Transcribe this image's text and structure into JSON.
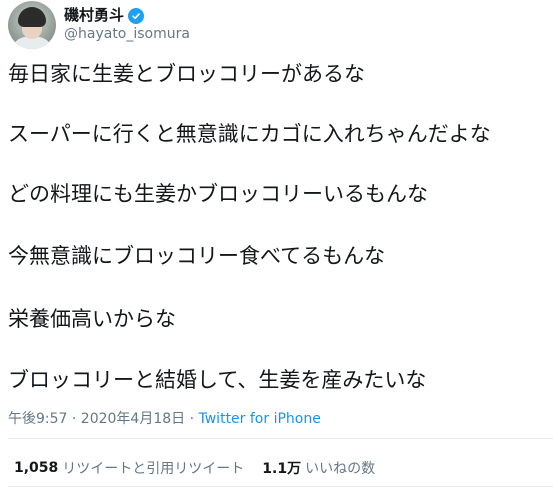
{
  "author": {
    "display_name": "磯村勇斗",
    "handle": "@hayato_isomura",
    "verified": true
  },
  "tweet": {
    "lines": [
      "毎日家に生姜とブロッコリーがあるな",
      "スーパーに行くと無意識にカゴに入れちゃんだよな",
      "どの料理にも生姜かブロッコリーいるもんな",
      "今無意識にブロッコリー食べてるもんな",
      "栄養価高いからな",
      "ブロッコリーと結婚して、生姜を産みたいな"
    ],
    "timestamp": "午後9:57 · 2020年4月18日 ·",
    "source": "Twitter for iPhone"
  },
  "stats": {
    "retweets_count": "1,058",
    "retweets_label": "リツイートと引用リツイート",
    "likes_count": "1.1万",
    "likes_label": "いいねの数"
  },
  "colors": {
    "text": "#14171a",
    "secondary": "#657786",
    "link": "#1b95e0",
    "verified": "#1da1f2"
  }
}
